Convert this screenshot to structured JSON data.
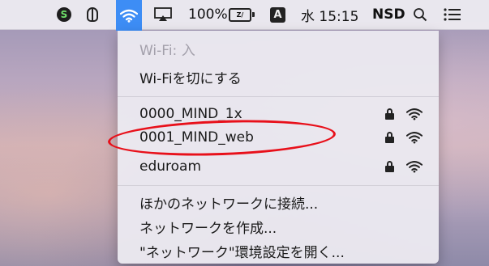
{
  "menubar": {
    "battery_percent": "100%",
    "battery_badge": "Z/",
    "input_mode": "A",
    "clock": "水 15:15",
    "user": "NSD"
  },
  "wifi_menu": {
    "status_text": "Wi-Fi: 入",
    "toggle_label": "Wi-Fiを切にする",
    "networks": [
      {
        "name": "0000_MIND_1x",
        "secured": true
      },
      {
        "name": "0001_MIND_web",
        "secured": true
      },
      {
        "name": "eduroam",
        "secured": true
      }
    ],
    "join_other": "ほかのネットワークに接続...",
    "create_network": "ネットワークを作成...",
    "open_prefs": "\"ネットワーク\"環境設定を開く..."
  },
  "annotation": {
    "color": "#e8101a"
  },
  "colors": {
    "accent": "#3d8df5"
  }
}
